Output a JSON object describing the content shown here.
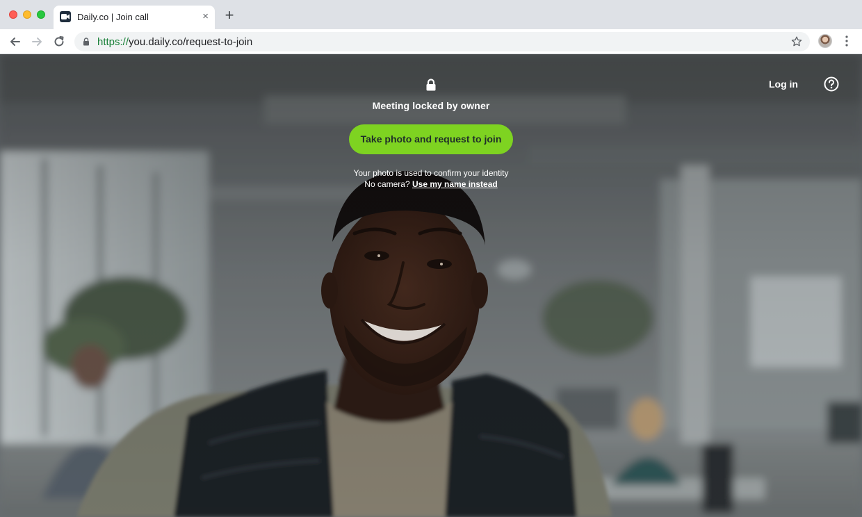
{
  "browser": {
    "tab_title": "Daily.co | Join call",
    "tab_close": "×",
    "new_tab": "+",
    "url_scheme": "https://",
    "url_rest": "you.daily.co/request-to-join"
  },
  "page": {
    "lock_icon": "lock-icon",
    "locked_text": "Meeting locked by owner",
    "cta_label": "Take photo and request to join",
    "cta_color": "#7ed321",
    "helper_line1": "Your photo is used to confirm your identity",
    "helper_line2_prefix": "No camera?",
    "helper_line2_link": "Use my name instead",
    "login_label": "Log in",
    "help_icon": "help-icon"
  }
}
